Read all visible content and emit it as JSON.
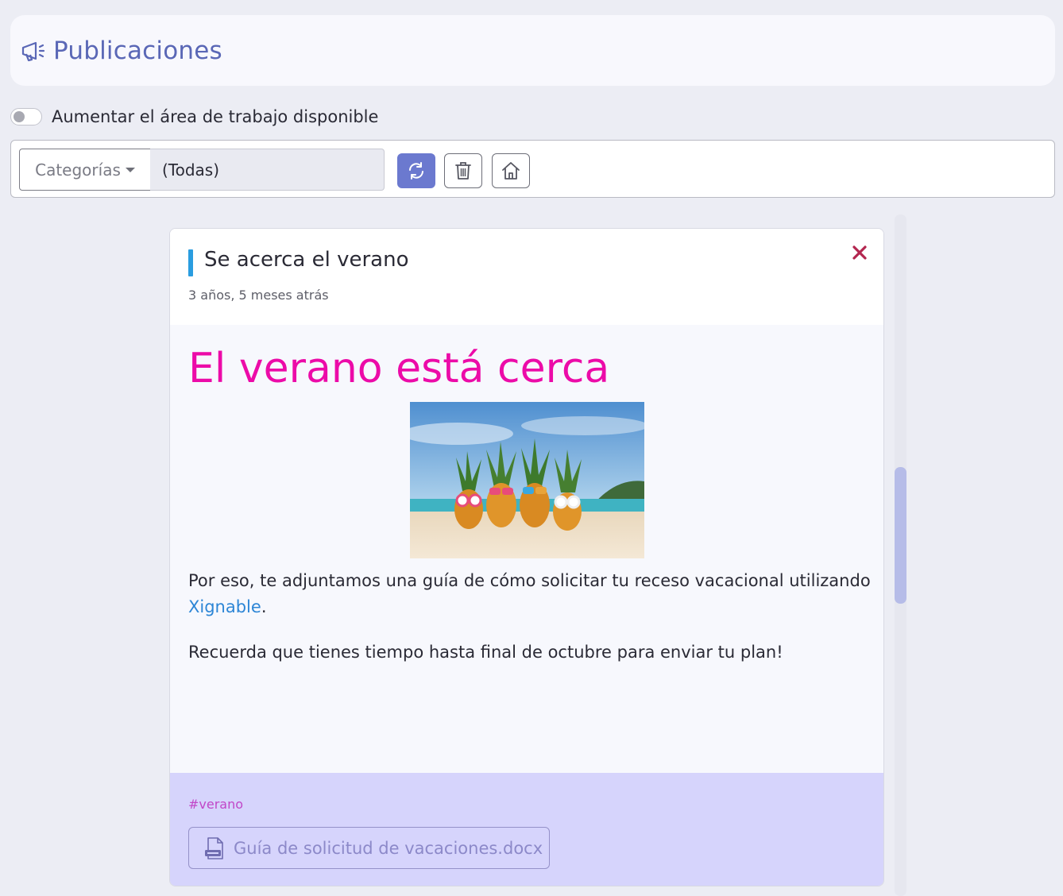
{
  "header": {
    "title": "Publicaciones",
    "icon": "megaphone-icon"
  },
  "workspace_toggle": {
    "label": "Aumentar el área de trabajo disponible",
    "checked": false
  },
  "toolbar": {
    "categories_label": "Categorías",
    "categories_value": "(Todas)",
    "buttons": [
      "refresh-icon",
      "trash-icon",
      "home-icon"
    ],
    "accent_color": "#6b79cf"
  },
  "post": {
    "title": "Se acerca el verano",
    "date": "3 años, 5 meses atrás",
    "heading": "El verano está cerca",
    "heading_color": "#ec0ba8",
    "paragraph1_text": "Por eso, te adjuntamos una guía de cómo solicitar tu receso vacacional utilizando",
    "paragraph1_link": "Xignable",
    "paragraph1_end": ".",
    "paragraph2": "Recuerda que tienes tiempo hasta final de octubre para enviar tu plan!",
    "tag": "#verano",
    "attachment": "Guía de solicitud de vacaciones.docx"
  }
}
